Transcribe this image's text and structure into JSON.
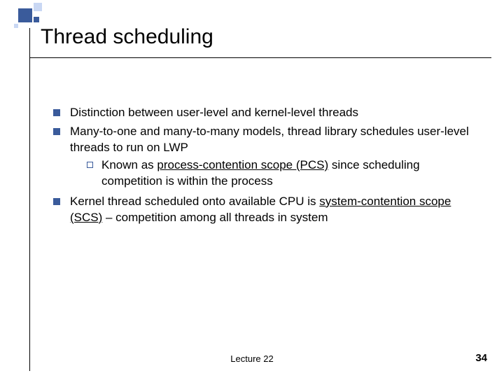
{
  "slide": {
    "title": "Thread scheduling",
    "footer_center": "Lecture 22",
    "page_number": "34",
    "bullets": {
      "b0": "Distinction between user-level and kernel-level threads",
      "b1_pre": "Many-to-one and many-to-many models, thread library schedules user-level threads to run on LWP",
      "b1_sub_pre": "Known as ",
      "b1_sub_u": "process-contention scope (PCS)",
      "b1_sub_post": " since scheduling competition is within the process",
      "b2_pre": "Kernel thread scheduled onto available CPU is ",
      "b2_u": "system-contention scope (SCS)",
      "b2_post": " – competition among all threads in system"
    }
  }
}
